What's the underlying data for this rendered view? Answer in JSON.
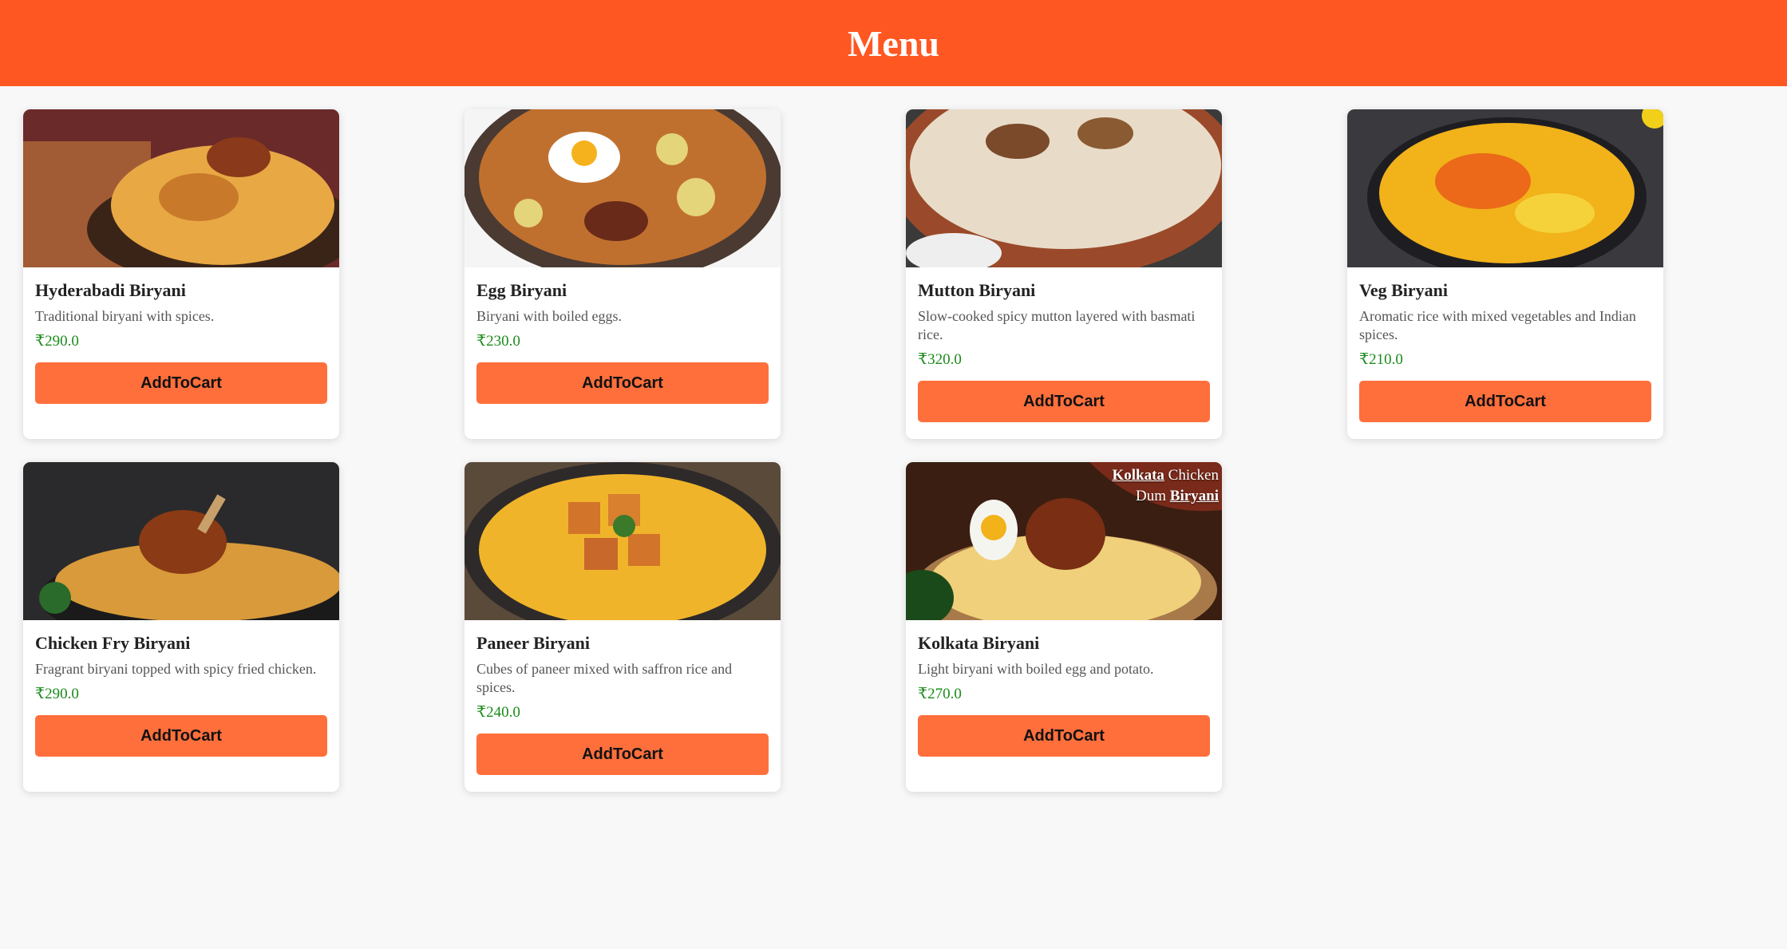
{
  "header": {
    "title": "Menu"
  },
  "theme": {
    "header_bg": "#ff5722",
    "button_bg": "#ff6f3c",
    "price_color": "#1a8a1a"
  },
  "items": [
    {
      "name": "Hyderabadi Biryani",
      "description": "Traditional biryani with spices.",
      "price": "₹290.0",
      "button": "AddToCart",
      "image": "hyderabadi-biryani-photo"
    },
    {
      "name": "Egg Biryani",
      "description": "Biryani with boiled eggs.",
      "price": "₹230.0",
      "button": "AddToCart",
      "image": "egg-biryani-photo"
    },
    {
      "name": "Mutton Biryani",
      "description": "Slow-cooked spicy mutton layered with basmati rice.",
      "price": "₹320.0",
      "button": "AddToCart",
      "image": "mutton-biryani-photo"
    },
    {
      "name": "Veg Biryani",
      "description": "Aromatic rice with mixed vegetables and Indian spices.",
      "price": "₹210.0",
      "button": "AddToCart",
      "image": "veg-biryani-photo"
    },
    {
      "name": "Chicken Fry Biryani",
      "description": "Fragrant biryani topped with spicy fried chicken.",
      "price": "₹290.0",
      "button": "AddToCart",
      "image": "chicken-fry-biryani-photo"
    },
    {
      "name": "Paneer Biryani",
      "description": "Cubes of paneer mixed with saffron rice and spices.",
      "price": "₹240.0",
      "button": "AddToCart",
      "image": "paneer-biryani-photo"
    },
    {
      "name": "Kolkata Biryani",
      "description": "Light biryani with boiled egg and potato.",
      "price": "₹270.0",
      "button": "AddToCart",
      "image": "kolkata-biryani-photo",
      "image_text": {
        "line1_a": "Kolkata",
        "line1_b": "Chicken",
        "line2_a": "Dum",
        "line2_b": "Biryani"
      }
    }
  ]
}
